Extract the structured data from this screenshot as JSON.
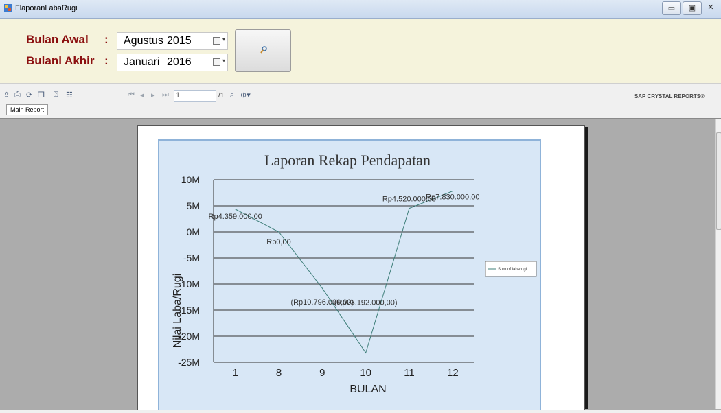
{
  "window": {
    "title": "FlaporanLabaRugi",
    "controls": [
      "▭",
      "▣",
      "✕"
    ]
  },
  "form": {
    "start_label": "Bulan Awal",
    "end_label": "Bulanl Akhir",
    "colon": ":",
    "start_month": "Agustus",
    "start_year": "2015",
    "end_month": "Januari",
    "end_year": "2016"
  },
  "toolbar": {
    "icons": [
      "export-icon",
      "print-icon",
      "refresh-icon",
      "copy-icon",
      "help-icon",
      "group-tree-icon",
      "first-page-icon",
      "prev-page-icon",
      "next-page-icon",
      "last-page-icon",
      "find-icon",
      "zoom-icon"
    ],
    "page_value": "1",
    "page_total": "/1",
    "brand": "SAP CRYSTAL REPORTS®"
  },
  "tabs": {
    "main_report": "Main Report"
  },
  "chart_data": {
    "type": "line",
    "title": "Laporan Rekap Pendapatan",
    "xlabel": "BULAN",
    "ylabel": "Nilai Laba/Rugi",
    "categories": [
      "1",
      "8",
      "9",
      "10",
      "11",
      "12"
    ],
    "series": [
      {
        "name": "Sum of labarugi",
        "values": [
          4359000,
          0,
          -10796000,
          -23192000,
          4520000,
          7830000
        ]
      }
    ],
    "data_labels": [
      "Rp4.359.000,00",
      "Rp0,00",
      "(Rp10.796.000,00)",
      "(Rp23.192.000,00)",
      "Rp4.520.000,00",
      "Rp7.830.000,00"
    ],
    "y_ticks": [
      "10M",
      "5M",
      "0M",
      "-5M",
      "-10M",
      "-15M",
      "-20M",
      "-25M"
    ],
    "ylim": [
      -25000000,
      10000000
    ],
    "grid": true,
    "legend": "right",
    "colors": {
      "background": "#d8e7f6",
      "border": "#8fb3d9",
      "line": "#3f7f7a"
    }
  }
}
